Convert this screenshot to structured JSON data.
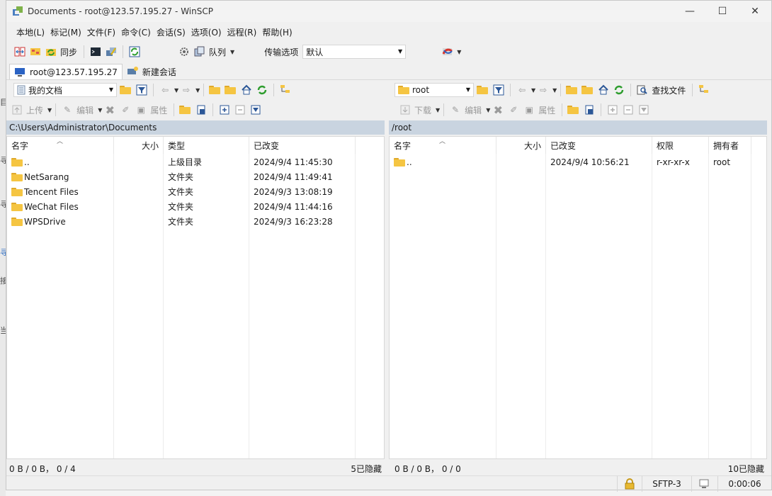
{
  "window": {
    "title": "Documents - root@123.57.195.27 - WinSCP"
  },
  "window_buttons": {
    "minimize": "—",
    "maximize": "☐",
    "close": "✕"
  },
  "menu": [
    "本地(L)",
    "标记(M)",
    "文件(F)",
    "命令(C)",
    "会话(S)",
    "选项(O)",
    "远程(R)",
    "帮助(H)"
  ],
  "toolbar": {
    "sync_label": "同步",
    "queue_label": "队列",
    "transfer_label": "传输选项",
    "transfer_value": "默认"
  },
  "tabs": [
    {
      "label": "root@123.57.195.27"
    },
    {
      "label": "新建会话"
    }
  ],
  "left": {
    "location": "我的文档",
    "upload_label": "上传",
    "edit_label": "编辑",
    "props_label": "属性",
    "path": "C:\\Users\\Administrator\\Documents",
    "columns": {
      "name": "名字",
      "size": "大小",
      "type": "类型",
      "changed": "已改变"
    },
    "rows": [
      {
        "name": "..",
        "size": "",
        "type": "上级目录",
        "changed": "2024/9/4  11:45:30"
      },
      {
        "name": "NetSarang",
        "size": "",
        "type": "文件夹",
        "changed": "2024/9/4  11:49:41"
      },
      {
        "name": "Tencent Files",
        "size": "",
        "type": "文件夹",
        "changed": "2024/9/3  13:08:19"
      },
      {
        "name": "WeChat Files",
        "size": "",
        "type": "文件夹",
        "changed": "2024/9/4  11:44:16"
      },
      {
        "name": "WPSDrive",
        "size": "",
        "type": "文件夹",
        "changed": "2024/9/3  16:23:28"
      }
    ],
    "status": "0 B / 0 B， 0 / 4",
    "hidden": "5已隐藏"
  },
  "right": {
    "location": "root",
    "download_label": "下载",
    "edit_label": "编辑",
    "props_label": "属性",
    "find_label": "查找文件",
    "path": "/root",
    "columns": {
      "name": "名字",
      "size": "大小",
      "changed": "已改变",
      "rights": "权限",
      "owner": "拥有者"
    },
    "rows": [
      {
        "name": "..",
        "size": "",
        "changed": "2024/9/4 10:56:21",
        "rights": "r-xr-xr-x",
        "owner": "root"
      }
    ],
    "status": "0 B / 0 B， 0 / 0",
    "hidden": "10已隐藏"
  },
  "statusbar": {
    "protocol": "SFTP-3",
    "time": "0:00:06"
  },
  "colors": {
    "path_bar": "#c9d4e0",
    "folder": "#f5c542",
    "refresh": "#2e9d2e"
  }
}
